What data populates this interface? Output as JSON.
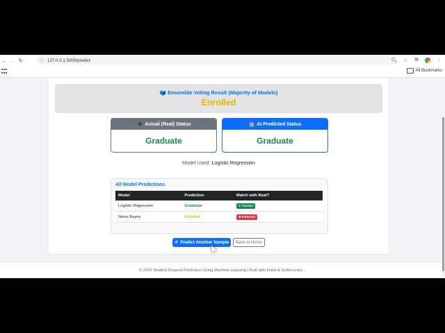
{
  "browser": {
    "url": "127.0.0.1:5000/predict",
    "all_bookmarks": "All Bookmarks"
  },
  "ensemble": {
    "icon": "🗳️",
    "title": "Ensemble Voting Result (Majority of Models)",
    "value": "Enrolled"
  },
  "actual_status": {
    "icon": "🎓",
    "label": "Actual (Real) Status",
    "value": "Graduate"
  },
  "ai_status": {
    "icon": "🤖",
    "label": "AI Predicted Status",
    "value": "Graduate"
  },
  "model_used": {
    "label": "Model Used:",
    "value": "Logistic Regression"
  },
  "predictions": {
    "title": "All Model Predictions",
    "columns": [
      "Model",
      "Prediction",
      "Match with Real?"
    ],
    "rows": [
      {
        "model": "Logistic Regression",
        "prediction": "Graduate",
        "match": "✔ Correct"
      },
      {
        "model": "Naive Bayes",
        "prediction": "Enrolled",
        "match": "✖ Incorrect"
      }
    ]
  },
  "buttons": {
    "predict_again": "Predict Another Sample",
    "back_home": "Back to Home"
  },
  "footer": "© 2024 Student Dropout Prediction Using Machine Learning | Built with Flask & Scikit-Learn",
  "colors": {
    "primary": "#0d6efd",
    "success": "#198754",
    "warning": "#f0b400",
    "danger": "#dc3545",
    "secondary": "#6c757d"
  }
}
